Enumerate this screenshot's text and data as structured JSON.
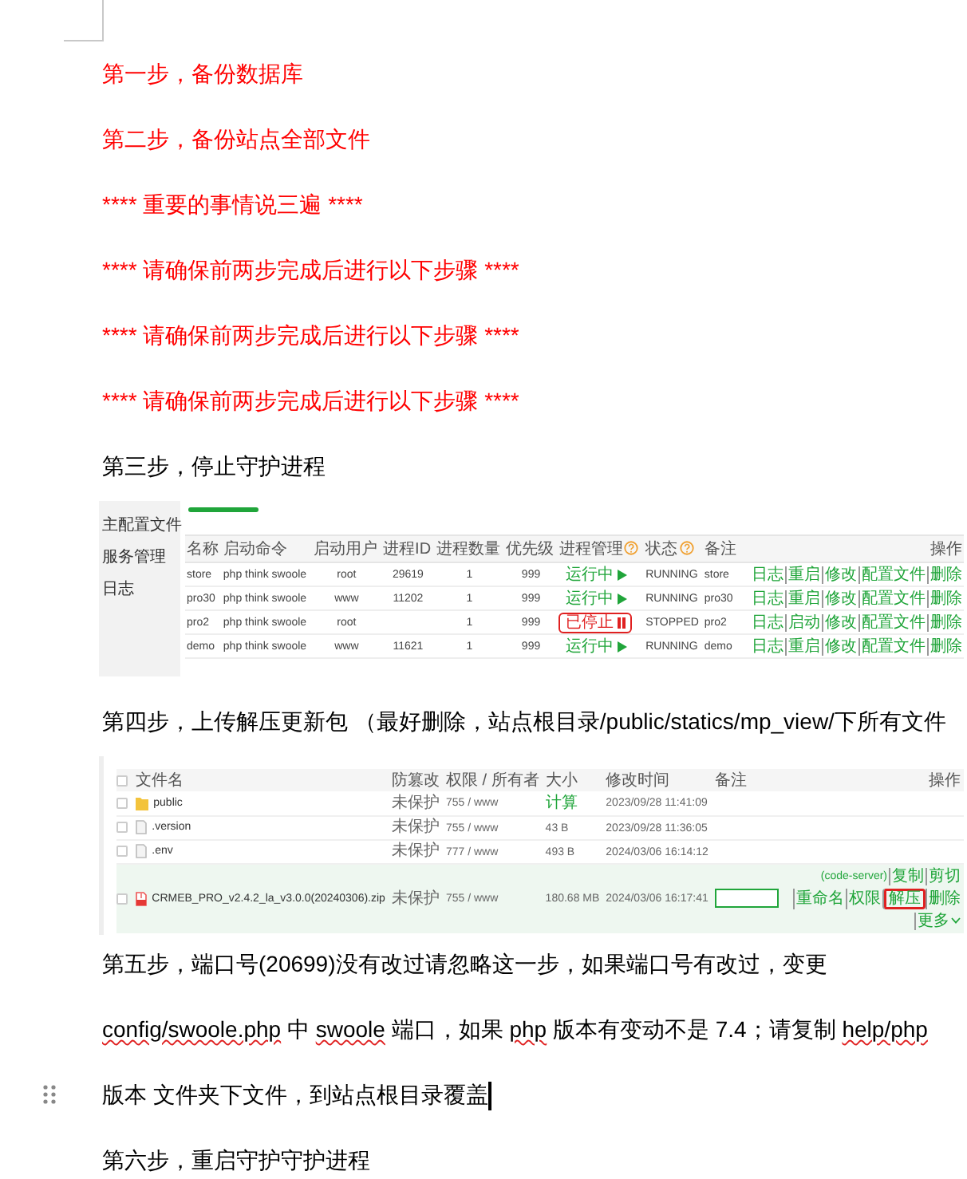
{
  "document": {
    "blocks": [
      {
        "kind": "paragraph",
        "color": "#ff0000",
        "focused": false,
        "segments": [
          {
            "text": "第一步，备份数据库",
            "misspelled": false
          }
        ]
      },
      {
        "kind": "paragraph",
        "color": "#ff0000",
        "focused": false,
        "segments": [
          {
            "text": "第二步，备份站点全部文件",
            "misspelled": false
          }
        ]
      },
      {
        "kind": "paragraph",
        "color": "#ff0000",
        "focused": false,
        "segments": [
          {
            "text": "**** 重要的事情说三遍 ****",
            "misspelled": false
          }
        ]
      },
      {
        "kind": "paragraph",
        "color": "#ff0000",
        "focused": false,
        "segments": [
          {
            "text": "**** 请确保前两步完成后进行以下步骤 ****",
            "misspelled": false
          }
        ]
      },
      {
        "kind": "paragraph",
        "color": "#ff0000",
        "focused": false,
        "segments": [
          {
            "text": "**** 请确保前两步完成后进行以下步骤 ****",
            "misspelled": false
          }
        ]
      },
      {
        "kind": "paragraph",
        "color": "#ff0000",
        "focused": false,
        "segments": [
          {
            "text": "**** 请确保前两步完成后进行以下步骤 ****",
            "misspelled": false
          }
        ]
      },
      {
        "kind": "paragraph",
        "color": "#000000",
        "focused": false,
        "segments": [
          {
            "text": "第三步，停止守护进程",
            "misspelled": false
          }
        ]
      },
      {
        "kind": "process-screenshot",
        "sidebar": [
          "主配置文件",
          "服务管理",
          "日志"
        ],
        "columns": [
          {
            "label": "名称",
            "help": false
          },
          {
            "label": "启动命令",
            "help": false
          },
          {
            "label": "启动用户",
            "help": false
          },
          {
            "label": "进程ID",
            "help": false
          },
          {
            "label": "进程数量",
            "help": false
          },
          {
            "label": "优先级",
            "help": false
          },
          {
            "label": "进程管理",
            "help": true
          },
          {
            "label": "状态",
            "help": true
          },
          {
            "label": "备注",
            "help": false
          },
          {
            "label": "操作",
            "help": false
          }
        ],
        "rows": [
          {
            "cells": [
              "store",
              "php think swoole",
              "root",
              "29619",
              "1",
              "999"
            ],
            "manage": {
              "label": "运行中",
              "running": true,
              "highlighted": false
            },
            "status": "RUNNING",
            "note": "store",
            "actions": [
              "日志",
              "重启",
              "修改",
              "配置文件",
              "删除"
            ]
          },
          {
            "cells": [
              "pro30",
              "php think swoole",
              "www",
              "11202",
              "1",
              "999"
            ],
            "manage": {
              "label": "运行中",
              "running": true,
              "highlighted": false
            },
            "status": "RUNNING",
            "note": "pro30",
            "actions": [
              "日志",
              "重启",
              "修改",
              "配置文件",
              "删除"
            ]
          },
          {
            "cells": [
              "pro2",
              "php think swoole",
              "root",
              "",
              "1",
              "999"
            ],
            "manage": {
              "label": "已停止",
              "running": false,
              "highlighted": true
            },
            "status": "STOPPED",
            "note": "pro2",
            "actions": [
              "日志",
              "启动",
              "修改",
              "配置文件",
              "删除"
            ]
          },
          {
            "cells": [
              "demo",
              "php think swoole",
              "www",
              "11621",
              "1",
              "999"
            ],
            "manage": {
              "label": "运行中",
              "running": true,
              "highlighted": false
            },
            "status": "RUNNING",
            "note": "demo",
            "actions": [
              "日志",
              "重启",
              "修改",
              "配置文件",
              "删除"
            ]
          }
        ]
      },
      {
        "kind": "paragraph",
        "color": "#000000",
        "focused": false,
        "segments": [
          {
            "text": "第四步，上传解压更新包 （最好删除，站点根目录/public/statics/mp_view/下所有文件",
            "misspelled": false
          }
        ]
      },
      {
        "kind": "file-screenshot",
        "all_checked": false,
        "columns": [
          "文件名",
          "防篡改",
          "权限 / 所有者",
          "大小",
          "修改时间",
          "备注",
          "操作"
        ],
        "rows": [
          {
            "kind": "folder",
            "checked": false,
            "name": "public",
            "protect": "未保护",
            "perm": "755 / www",
            "size": "计算",
            "size_link": true,
            "time": "2023/09/28 11:41:09",
            "selected": false
          },
          {
            "kind": "file",
            "checked": false,
            "name": ".version",
            "protect": "未保护",
            "perm": "755 / www",
            "size": "43 B",
            "size_link": false,
            "time": "2023/09/28 11:36:05",
            "selected": false
          },
          {
            "kind": "file",
            "checked": false,
            "name": ".env",
            "protect": "未保护",
            "perm": "777 / www",
            "size": "493 B",
            "size_link": false,
            "time": "2024/03/06 16:14:12",
            "selected": false
          },
          {
            "kind": "zip",
            "checked": false,
            "name": "CRMEB_PRO_v2.4.2_la_v3.0.0(20240306).zip",
            "protect": "未保护",
            "perm": "755 / www",
            "size": "180.68 MB",
            "size_link": false,
            "time": "2024/03/06 16:17:41",
            "selected": true,
            "actions": [
              {
                "label": "(code-server)",
                "highlighted": false,
                "dropdown": false
              },
              {
                "label": "复制",
                "highlighted": false,
                "dropdown": false
              },
              {
                "label": "剪切",
                "highlighted": false,
                "dropdown": false
              },
              {
                "label": "重命名",
                "highlighted": false,
                "dropdown": false
              },
              {
                "label": "权限",
                "highlighted": false,
                "dropdown": false
              },
              {
                "label": "解压",
                "highlighted": true,
                "dropdown": false
              },
              {
                "label": "删除",
                "highlighted": false,
                "dropdown": false
              },
              {
                "label": "更多",
                "highlighted": false,
                "dropdown": true
              }
            ]
          }
        ]
      },
      {
        "kind": "paragraph",
        "color": "#000000",
        "focused": false,
        "segments": [
          {
            "text": "第五步，端口号(20699)没有改过请忽略这一步，如果端口号有改过，变更",
            "misspelled": false
          }
        ]
      },
      {
        "kind": "paragraph",
        "color": "#000000",
        "focused": false,
        "segments": [
          {
            "text": "config/swoole.php",
            "misspelled": true
          },
          {
            "text": " 中 ",
            "misspelled": false
          },
          {
            "text": "swoole",
            "misspelled": true
          },
          {
            "text": " 端口，如果 ",
            "misspelled": false
          },
          {
            "text": "php",
            "misspelled": true
          },
          {
            "text": " 版本有变动不是 7.4；请复制 ",
            "misspelled": false
          },
          {
            "text": "help/php",
            "misspelled": true
          }
        ]
      },
      {
        "kind": "paragraph",
        "color": "#000000",
        "focused": true,
        "segments": [
          {
            "text": "版本 文件夹下文件，到站点根目录覆盖",
            "misspelled": false
          }
        ]
      },
      {
        "kind": "paragraph",
        "color": "#000000",
        "focused": false,
        "segments": [
          {
            "text": "第六步，重启守护守护进程",
            "misspelled": false
          }
        ]
      }
    ]
  }
}
